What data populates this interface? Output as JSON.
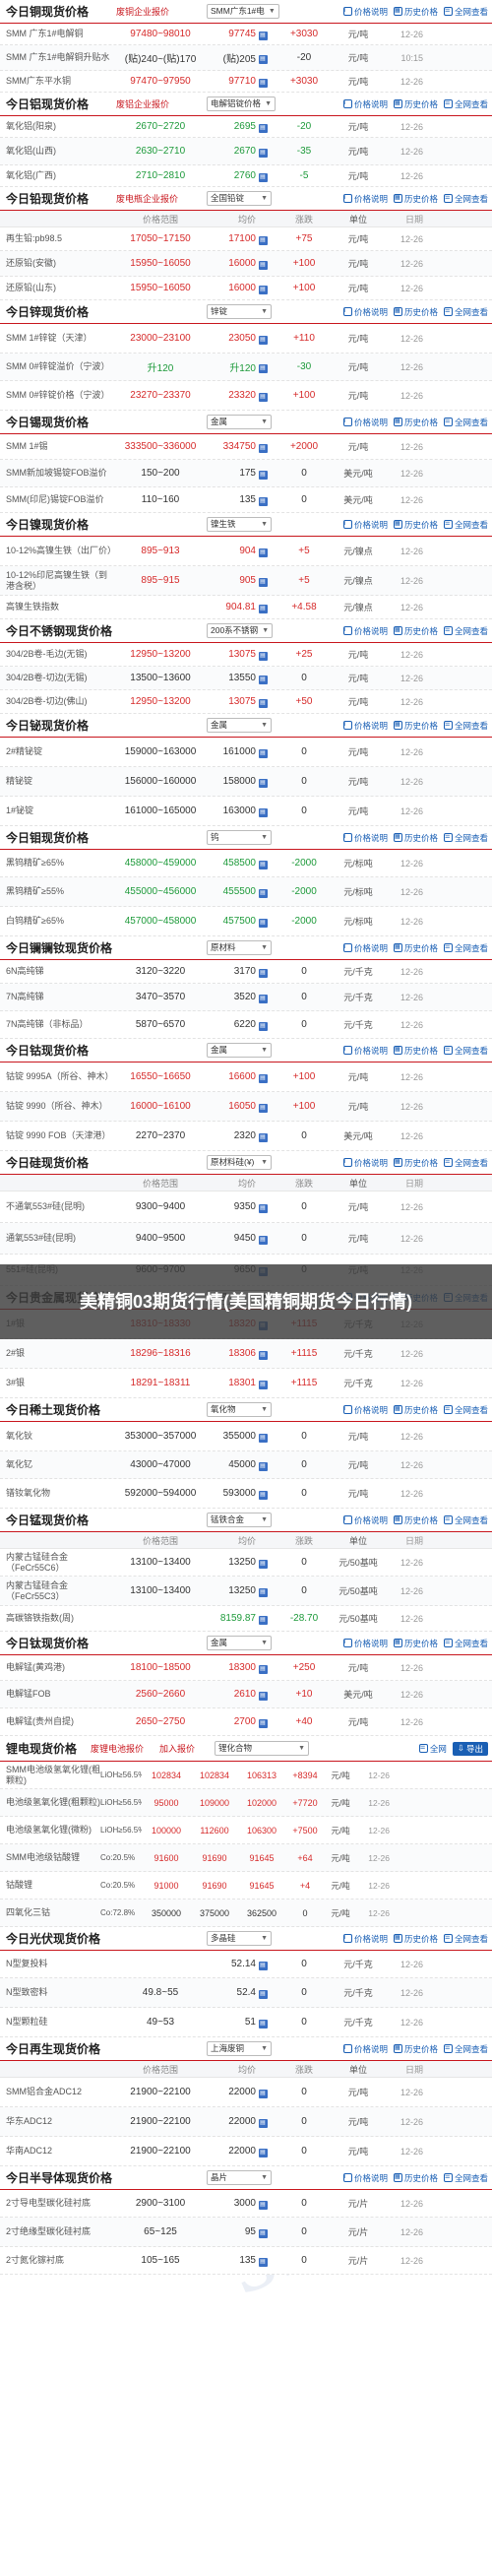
{
  "overlay": {
    "title": "美精铜03期货行情(美国精铜期货今日行情)"
  },
  "tools": {
    "explain": "价格说明",
    "history": "历史价格",
    "all": "全网查看"
  },
  "columns": {
    "name": "",
    "range": "价格范围",
    "avg": "均价",
    "change": "涨跌",
    "unit": "单位",
    "date": "日期"
  },
  "colors": {
    "accent": "#c8161d",
    "up": "#d62a2a",
    "down": "#1d9a3a",
    "link": "#1a5fb4"
  },
  "sections": [
    {
      "title": "今日铜现货价格",
      "source": "废铜企业报价",
      "select": "SMM广东1#电",
      "header_cols": false,
      "rows": [
        {
          "name": "SMM 广东1#电解铜",
          "range": "97480~98010",
          "avg": "97745",
          "change": "+3030",
          "unit": "元/吨",
          "date": "12-26",
          "dir": "up",
          "h": 22
        },
        {
          "name": "SMM 广东1#电解铜升贴水",
          "range": "(贴)240~(贴)170",
          "avg": "(贴)205",
          "change": "-20",
          "unit": "元/吨",
          "date": "10:15",
          "dir": "fl",
          "h": 26
        },
        {
          "name": "SMM广东平水铜",
          "range": "97470~97950",
          "avg": "97710",
          "change": "+3030",
          "unit": "元/吨",
          "date": "12-26",
          "dir": "up",
          "h": 22
        }
      ]
    },
    {
      "title": "今日铝现货价格",
      "source": "废铝企业报价",
      "select": "电解铝锭价格",
      "header_cols": false,
      "rows": [
        {
          "name": "氧化铝(阳泉)",
          "range": "2670~2720",
          "avg": "2695",
          "change": "-20",
          "unit": "元/吨",
          "date": "12-26",
          "dir": "dn",
          "h": 22
        },
        {
          "name": "氧化铝(山西)",
          "range": "2630~2710",
          "avg": "2670",
          "change": "-35",
          "unit": "元/吨",
          "date": "12-26",
          "dir": "dn",
          "h": 28
        },
        {
          "name": "氧化铝(广西)",
          "range": "2710~2810",
          "avg": "2760",
          "change": "-5",
          "unit": "元/吨",
          "date": "12-26",
          "dir": "dn",
          "h": 22
        }
      ]
    },
    {
      "title": "今日铅现货价格",
      "source": "废电瓶企业报价",
      "select": "全国铅锭",
      "header_cols": true,
      "rows": [
        {
          "name": "再生铅:pb98.5",
          "range": "17050~17150",
          "avg": "17100",
          "change": "+75",
          "unit": "元/吨",
          "date": "12-26",
          "dir": "up",
          "h": 24
        },
        {
          "name": "还原铅(安徽)",
          "range": "15950~16050",
          "avg": "16000",
          "change": "+100",
          "unit": "元/吨",
          "date": "12-26",
          "dir": "up",
          "h": 26
        },
        {
          "name": "还原铅(山东)",
          "range": "15950~16050",
          "avg": "16000",
          "change": "+100",
          "unit": "元/吨",
          "date": "12-26",
          "dir": "up",
          "h": 24
        }
      ]
    },
    {
      "title": "今日锌现货价格",
      "source": "",
      "select": "锌锭",
      "header_cols": false,
      "rows": [
        {
          "name": "SMM 1#锌锭（天津）",
          "range": "23000~23100",
          "avg": "23050",
          "change": "+110",
          "unit": "元/吨",
          "date": "12-26",
          "dir": "up",
          "h": 30
        },
        {
          "name": "SMM 0#锌锭溢价（宁波）",
          "range": "升120",
          "avg": "升120",
          "change": "-30",
          "unit": "元/吨",
          "date": "12-26",
          "dir": "dn",
          "h": 28
        },
        {
          "name": "SMM 0#锌锭价格（宁波）",
          "range": "23270~23370",
          "avg": "23320",
          "change": "+100",
          "unit": "元/吨",
          "date": "12-26",
          "dir": "up",
          "h": 30
        }
      ]
    },
    {
      "title": "今日锡现货价格",
      "source": "",
      "select": "金属",
      "header_cols": false,
      "rows": [
        {
          "name": "SMM 1#锡",
          "range": "333500~336000",
          "avg": "334750",
          "change": "+2000",
          "unit": "元/吨",
          "date": "12-26",
          "dir": "up",
          "h": 26
        },
        {
          "name": "SMM新加坡锡锭FOB溢价",
          "range": "150~200",
          "avg": "175",
          "change": "0",
          "unit": "美元/吨",
          "date": "12-26",
          "dir": "fl",
          "h": 28
        },
        {
          "name": "SMM(印尼)锡锭FOB溢价",
          "range": "110~160",
          "avg": "135",
          "change": "0",
          "unit": "美元/吨",
          "date": "12-26",
          "dir": "fl",
          "h": 26
        }
      ]
    },
    {
      "title": "今日镍现货价格",
      "source": "",
      "select": "镍生铁",
      "header_cols": false,
      "rows": [
        {
          "name": "10-12%高镍生铁（出厂价）",
          "range": "895~913",
          "avg": "904",
          "change": "+5",
          "unit": "元/镍点",
          "date": "12-26",
          "dir": "up",
          "h": 30
        },
        {
          "name": "10-12%印尼高镍生铁（到港含税）",
          "range": "895~915",
          "avg": "905",
          "change": "+5",
          "unit": "元/镍点",
          "date": "12-26",
          "dir": "up",
          "h": 30
        },
        {
          "name": "高镍生铁指数",
          "range": "",
          "avg": "904.81",
          "change": "+4.58",
          "unit": "元/镍点",
          "date": "12-26",
          "dir": "up",
          "h": 24,
          "note": true
        }
      ]
    },
    {
      "title": "今日不锈钢现货价格",
      "source": "",
      "select": "200系不锈钢",
      "header_cols": false,
      "rows": [
        {
          "name": "304/2B卷-毛边(无锡)",
          "range": "12950~13200",
          "avg": "13075",
          "change": "+25",
          "unit": "元/吨",
          "date": "12-26",
          "dir": "up",
          "h": 24
        },
        {
          "name": "304/2B卷-切边(无锡)",
          "range": "13500~13600",
          "avg": "13550",
          "change": "0",
          "unit": "元/吨",
          "date": "12-26",
          "dir": "fl",
          "h": 24
        },
        {
          "name": "304/2B卷-切边(佛山)",
          "range": "12950~13200",
          "avg": "13075",
          "change": "+50",
          "unit": "元/吨",
          "date": "12-26",
          "dir": "up",
          "h": 24
        }
      ]
    },
    {
      "title": "今日铋现货价格",
      "source": "",
      "select": "金属",
      "header_cols": false,
      "rows": [
        {
          "name": "2#精铋锭",
          "range": "159000~163000",
          "avg": "161000",
          "change": "0",
          "unit": "元/吨",
          "date": "12-26",
          "dir": "fl",
          "h": 30
        },
        {
          "name": "精铋锭",
          "range": "156000~160000",
          "avg": "158000",
          "change": "0",
          "unit": "元/吨",
          "date": "12-26",
          "dir": "fl",
          "h": 30
        },
        {
          "name": "1#铋锭",
          "range": "161000~165000",
          "avg": "163000",
          "change": "0",
          "unit": "元/吨",
          "date": "12-26",
          "dir": "fl",
          "h": 30
        }
      ]
    },
    {
      "title": "今日钼现货价格",
      "source": "",
      "select": "钨",
      "header_cols": false,
      "rows": [
        {
          "name": "黑钨精矿≥65%",
          "range": "458000~459000",
          "avg": "458500",
          "change": "-2000",
          "unit": "元/标吨",
          "date": "12-26",
          "dir": "dn",
          "h": 28
        },
        {
          "name": "黑钨精矿≥55%",
          "range": "455000~456000",
          "avg": "455500",
          "change": "-2000",
          "unit": "元/标吨",
          "date": "12-26",
          "dir": "dn",
          "h": 30
        },
        {
          "name": "白钨精矿≥65%",
          "range": "457000~458000",
          "avg": "457500",
          "change": "-2000",
          "unit": "元/标吨",
          "date": "12-26",
          "dir": "dn",
          "h": 30
        }
      ]
    },
    {
      "title": "今日镧镧钕现货价格",
      "source": "",
      "select": "原材料",
      "header_cols": false,
      "rows": [
        {
          "name": "6N高纯锑",
          "range": "3120~3220",
          "avg": "3170",
          "change": "0",
          "unit": "元/千克",
          "date": "12-26",
          "dir": "fl",
          "h": 24
        },
        {
          "name": "7N高纯锑",
          "range": "3470~3570",
          "avg": "3520",
          "change": "0",
          "unit": "元/千克",
          "date": "12-26",
          "dir": "fl",
          "h": 28
        },
        {
          "name": "7N高纯锑（非标品）",
          "range": "5870~6570",
          "avg": "6220",
          "change": "0",
          "unit": "元/千克",
          "date": "12-26",
          "dir": "fl",
          "h": 28
        }
      ]
    },
    {
      "title": "今日钴现货价格",
      "source": "",
      "select": "金属",
      "header_cols": false,
      "rows": [
        {
          "name": "钴锭 9995A（所谷、神木）",
          "range": "16550~16650",
          "avg": "16600",
          "change": "+100",
          "unit": "元/吨",
          "date": "12-26",
          "dir": "up",
          "h": 30
        },
        {
          "name": "钴锭 9990（所谷、神木）",
          "range": "16000~16100",
          "avg": "16050",
          "change": "+100",
          "unit": "元/吨",
          "date": "12-26",
          "dir": "up",
          "h": 30
        },
        {
          "name": "钴锭 9990 FOB（天津港）",
          "range": "2270~2370",
          "avg": "2320",
          "change": "0",
          "unit": "美元/吨",
          "date": "12-26",
          "dir": "fl",
          "h": 30
        }
      ]
    },
    {
      "title": "今日硅现货价格",
      "source": "",
      "select": "原材料硅(¥)",
      "header_cols": true,
      "rows": [
        {
          "name": "不通氧553#硅(昆明)",
          "range": "9300~9400",
          "avg": "9350",
          "change": "0",
          "unit": "元/吨",
          "date": "12-26",
          "dir": "fl",
          "h": 32
        },
        {
          "name": "通氧553#硅(昆明)",
          "range": "9400~9500",
          "avg": "9450",
          "change": "0",
          "unit": "元/吨",
          "date": "12-26",
          "dir": "fl",
          "h": 32
        },
        {
          "name": "551#硅(昆明)",
          "range": "9600~9700",
          "avg": "9650",
          "change": "0",
          "unit": "元/吨",
          "date": "12-26",
          "dir": "fl",
          "h": 32
        }
      ]
    },
    {
      "title": "今日贵金属现货价格",
      "source": "",
      "select": "白银",
      "header_cols": false,
      "rows": [
        {
          "name": "1#银",
          "range": "18310~18330",
          "avg": "18320",
          "change": "+1115",
          "unit": "元/千克",
          "date": "12-26",
          "dir": "up",
          "h": 30
        },
        {
          "name": "2#银",
          "range": "18296~18316",
          "avg": "18306",
          "change": "+1115",
          "unit": "元/千克",
          "date": "12-26",
          "dir": "up",
          "h": 30
        },
        {
          "name": "3#银",
          "range": "18291~18311",
          "avg": "18301",
          "change": "+1115",
          "unit": "元/千克",
          "date": "12-26",
          "dir": "up",
          "h": 30
        }
      ]
    },
    {
      "title": "今日稀土现货价格",
      "source": "",
      "select": "氧化物",
      "header_cols": false,
      "rows": [
        {
          "name": "氧化钬",
          "range": "353000~357000",
          "avg": "355000",
          "change": "0",
          "unit": "元/吨",
          "date": "12-26",
          "dir": "fl",
          "h": 30
        },
        {
          "name": "氧化钇",
          "range": "43000~47000",
          "avg": "45000",
          "change": "0",
          "unit": "元/吨",
          "date": "12-26",
          "dir": "fl",
          "h": 28
        },
        {
          "name": "镨钕氧化物",
          "range": "592000~594000",
          "avg": "593000",
          "change": "0",
          "unit": "元/吨",
          "date": "12-26",
          "dir": "fl",
          "h": 30
        }
      ]
    },
    {
      "title": "今日锰现货价格",
      "source": "",
      "select": "锰铁合金",
      "header_cols": true,
      "rows": [
        {
          "name": "内蒙古锰硅合金（FeCr55C6）",
          "range": "13100~13400",
          "avg": "13250",
          "change": "0",
          "unit": "元/50基吨",
          "date": "12-26",
          "dir": "fl",
          "h": 28
        },
        {
          "name": "内蒙古锰硅合金（FeCr55C3）",
          "range": "13100~13400",
          "avg": "13250",
          "change": "0",
          "unit": "元/50基吨",
          "date": "12-26",
          "dir": "fl",
          "h": 30
        },
        {
          "name": "高碳铬铁指数(周)",
          "range": "",
          "avg": "8159.87",
          "change": "-28.70",
          "unit": "元/50基吨",
          "date": "12-26",
          "dir": "dn",
          "h": 26
        }
      ]
    },
    {
      "title": "今日钛现货价格",
      "source": "",
      "select": "金属",
      "header_cols": false,
      "rows": [
        {
          "name": "电解锰(黄鸡港)",
          "range": "18100~18500",
          "avg": "18300",
          "change": "+250",
          "unit": "元/吨",
          "date": "12-26",
          "dir": "up",
          "h": 26
        },
        {
          "name": "电解锰FOB",
          "range": "2560~2660",
          "avg": "2610",
          "change": "+10",
          "unit": "美元/吨",
          "date": "12-26",
          "dir": "up",
          "h": 28
        },
        {
          "name": "电解锰(贵州自提)",
          "range": "2650~2750",
          "avg": "2700",
          "change": "+40",
          "unit": "元/吨",
          "date": "12-26",
          "dir": "up",
          "h": 28
        }
      ]
    }
  ],
  "lithium": {
    "title": "锂电现货价格",
    "source": "废锂电池报价",
    "join": "加入报价",
    "select": "锂化合物",
    "all": "全网",
    "export": "导出",
    "rows": [
      {
        "name": "SMM电池级氢氧化锂(粗颗粒)",
        "content": "LiOH≥56.5%",
        "range_low": "102834",
        "range_high": "102834",
        "avg": "106313",
        "change": "+8394",
        "unit": "元/吨",
        "date": "12-26",
        "dir": "up"
      },
      {
        "name": "电池级氢氧化锂(粗颗粒)",
        "content": "LiOH≥56.5%",
        "range_low": "95000",
        "range_high": "109000",
        "avg": "102000",
        "change": "+7720",
        "unit": "元/吨",
        "date": "12-26",
        "dir": "up"
      },
      {
        "name": "电池级氢氧化锂(微粉)",
        "content": "LiOH≥56.5%",
        "range_low": "100000",
        "range_high": "112600",
        "avg": "106300",
        "change": "+7500",
        "unit": "元/吨",
        "date": "12-26",
        "dir": "up"
      },
      {
        "name": "SMM电池级钴酸锂",
        "content": "Co:20.5%",
        "range_low": "91600",
        "range_high": "91690",
        "avg": "91645",
        "change": "+64",
        "unit": "元/吨",
        "date": "12-26",
        "dir": "up"
      },
      {
        "name": "钴酸锂",
        "content": "Co:20.5%",
        "range_low": "91000",
        "range_high": "91690",
        "avg": "91645",
        "change": "+4",
        "unit": "元/吨",
        "date": "12-26",
        "dir": "up"
      },
      {
        "name": "四氧化三钴",
        "content": "Co:72.8%",
        "range_low": "350000",
        "range_high": "375000",
        "avg": "362500",
        "change": "0",
        "unit": "元/吨",
        "date": "12-26",
        "dir": "fl"
      }
    ]
  },
  "sections2": [
    {
      "title": "今日光伏现货价格",
      "source": "",
      "select": "多晶硅",
      "header_cols": false,
      "rows": [
        {
          "name": "N型复投料",
          "range": "",
          "avg": "52.14",
          "change": "0",
          "unit": "元/千克",
          "date": "12-26",
          "dir": "fl",
          "h": 28,
          "note": true
        },
        {
          "name": "N型致密料",
          "range": "49.8~55",
          "avg": "52.4",
          "change": "0",
          "unit": "元/千克",
          "date": "12-26",
          "dir": "fl",
          "h": 30
        },
        {
          "name": "N型颗粒硅",
          "range": "49~53",
          "avg": "51",
          "change": "0",
          "unit": "元/千克",
          "date": "12-26",
          "dir": "fl",
          "h": 30
        }
      ]
    },
    {
      "title": "今日再生现货价格",
      "source": "",
      "select": "上海废铜",
      "header_cols": true,
      "rows": [
        {
          "name": "SMM铝合金ADC12",
          "range": "21900~22100",
          "avg": "22000",
          "change": "0",
          "unit": "元/吨",
          "date": "12-26",
          "dir": "fl",
          "h": 30
        },
        {
          "name": "华东ADC12",
          "range": "21900~22100",
          "avg": "22000",
          "change": "0",
          "unit": "元/吨",
          "date": "12-26",
          "dir": "fl",
          "h": 30
        },
        {
          "name": "华南ADC12",
          "range": "21900~22100",
          "avg": "22000",
          "change": "0",
          "unit": "元/吨",
          "date": "12-26",
          "dir": "fl",
          "h": 30
        }
      ]
    },
    {
      "title": "今日半导体现货价格",
      "source": "",
      "select": "晶片",
      "header_cols": false,
      "rows": [
        {
          "name": "2寸导电型碳化硅衬底",
          "range": "2900~3100",
          "avg": "3000",
          "change": "0",
          "unit": "元/片",
          "date": "12-26",
          "dir": "fl",
          "h": 28
        },
        {
          "name": "2寸绝缘型碳化硅衬底",
          "range": "65~125",
          "avg": "95",
          "change": "0",
          "unit": "元/片",
          "date": "12-26",
          "dir": "fl",
          "h": 30
        },
        {
          "name": "2寸氮化镓衬底",
          "range": "105~165",
          "avg": "135",
          "change": "0",
          "unit": "元/片",
          "date": "12-26",
          "dir": "fl",
          "h": 28
        }
      ]
    }
  ]
}
